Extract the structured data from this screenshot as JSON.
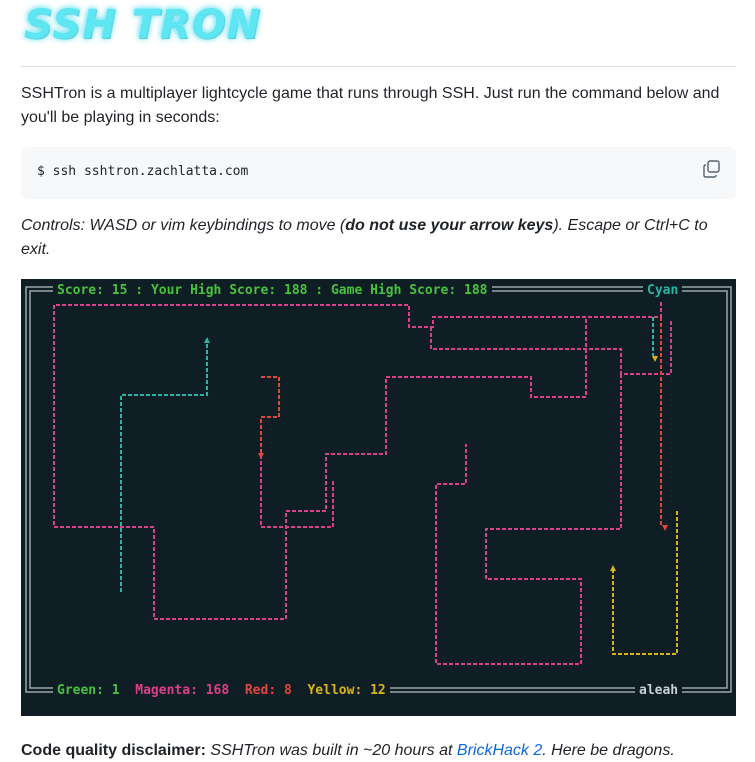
{
  "header": {
    "logo_text": "SSH TRON"
  },
  "intro": {
    "text": "SSHTron is a multiplayer lightcycle game that runs through SSH. Just run the command below and you'll be playing in seconds:"
  },
  "code": {
    "command": "$ ssh sshtron.zachlatta.com",
    "copy_icon": "copy-icon"
  },
  "controls": {
    "prefix": "Controls: WASD or vim keybindings to move (",
    "bold": "do not use your arrow keys",
    "suffix": "). Escape or Ctrl+C to exit."
  },
  "game": {
    "status": {
      "score_label": "Score: 15",
      "your_high": "Your High Score: 188",
      "game_high": "Game High Score: 188",
      "player_color": "Cyan"
    },
    "players": {
      "green": "Green: 1",
      "magenta": "Magenta: 168",
      "red": "Red: 8",
      "yellow": "Yellow: 12",
      "name": "aleah"
    },
    "colors": {
      "background": "#0f1e24",
      "border": "#9aa6a9",
      "cyan": "#2bb3a6",
      "magenta": "#d9408a",
      "red": "#e2453c",
      "yellow": "#d9b514",
      "green": "#46c33a"
    }
  },
  "disclaimer": {
    "label": "Code quality disclaimer:",
    "text_before": "SSHTron was built in ~20 hours at",
    "link": "BrickHack 2",
    "text_after": ". Here be dragons."
  }
}
